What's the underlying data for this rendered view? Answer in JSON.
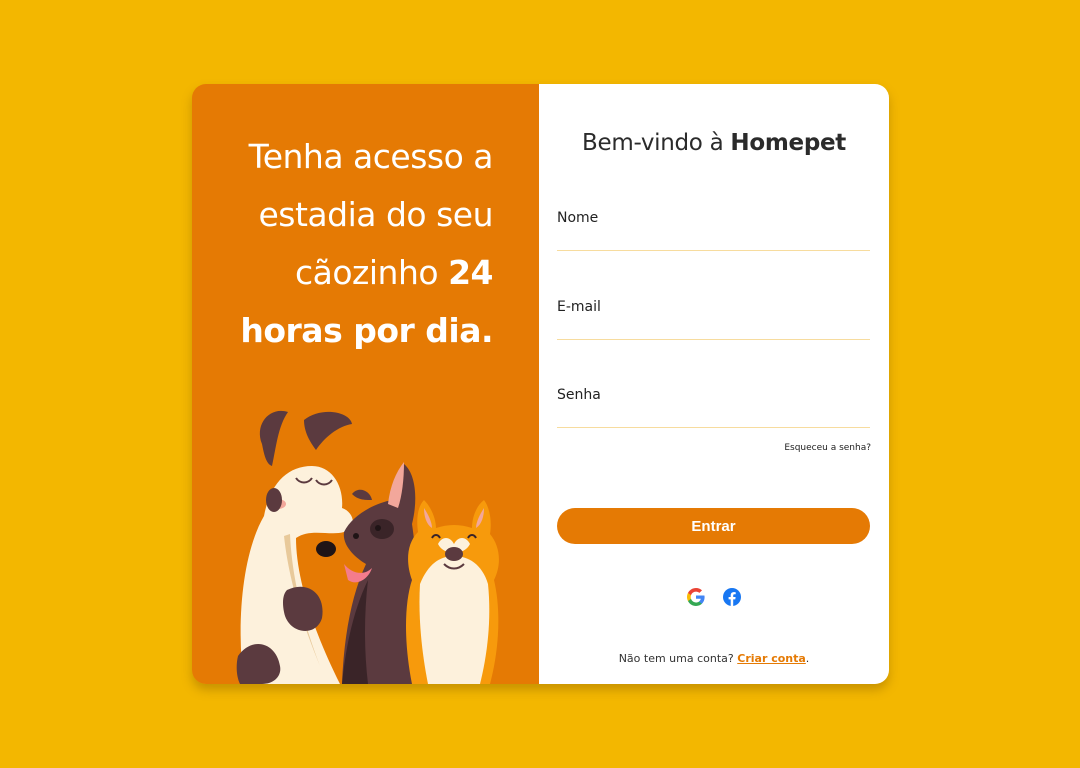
{
  "left_panel": {
    "headline_regular": "Tenha acesso a estadia do seu cãozinho ",
    "headline_bold": "24 horas por dia."
  },
  "form": {
    "welcome_prefix": "Bem-vindo à ",
    "welcome_brand": "Homepet",
    "name_label": "Nome",
    "email_label": "E-mail",
    "password_label": "Senha",
    "forgot_password": "Esqueceu a senha?",
    "submit_label": "Entrar",
    "social": [
      "google-icon",
      "facebook-icon"
    ],
    "signup_prefix": "Não tem uma conta? ",
    "signup_link": "Criar conta",
    "signup_suffix": "."
  },
  "colors": {
    "background": "#f3b700",
    "accent": "#e57a04",
    "field_line": "#f7dc9e"
  }
}
